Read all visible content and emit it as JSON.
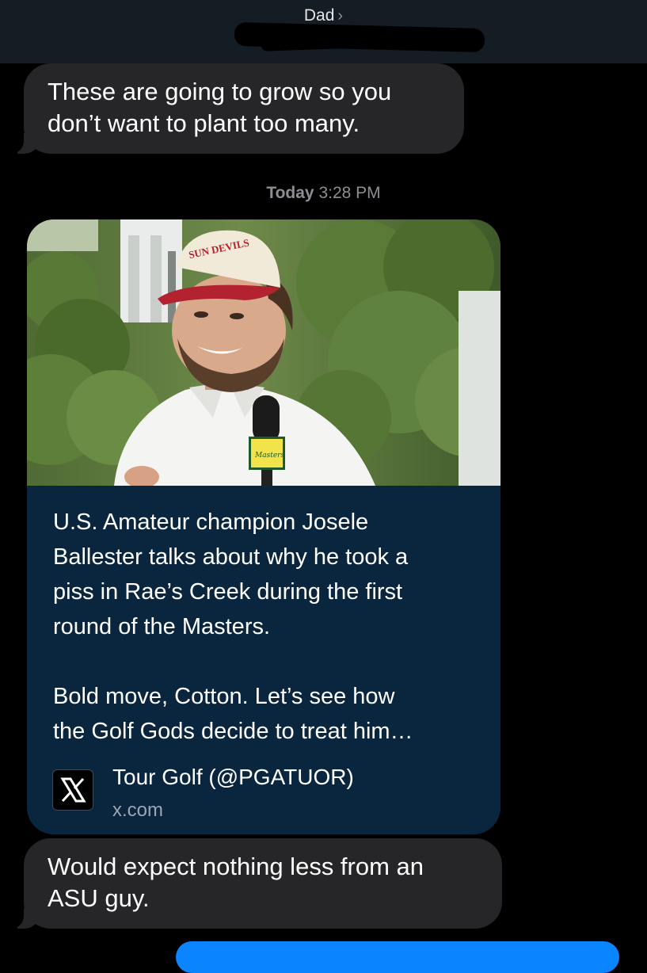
{
  "header": {
    "contact_name": "Dad",
    "chevron": "›"
  },
  "messages": {
    "first": {
      "line1": "These are going to grow so you",
      "line2": "don’t want to plant too many."
    },
    "timestamp": {
      "day": "Today",
      "time": "3:28 PM"
    },
    "link_card": {
      "text_p1_l1": "U.S. Amateur champion Josele",
      "text_p1_l2": "Ballester talks about why he took a",
      "text_p1_l3": "piss in Rae’s Creek during the first",
      "text_p1_l4": "round of the Masters.",
      "text_p2_l1": "Bold move, Cotton. Let’s see how",
      "text_p2_l2": "the Golf Gods decide to treat him…",
      "source_title": "Tour Golf (@PGATUOR)",
      "source_domain": "x.com",
      "source_icon": "x-logo-icon",
      "image_caption": "SUN DEVILS",
      "mic_label": "Masters"
    },
    "last": {
      "line1": "Would expect nothing less from an",
      "line2": "ASU guy."
    }
  },
  "colors": {
    "background": "#000000",
    "incoming_bubble": "#262628",
    "card_body": "#0a263f",
    "outgoing_bubble": "#0a84ff",
    "timestamp": "#8d8d93"
  }
}
